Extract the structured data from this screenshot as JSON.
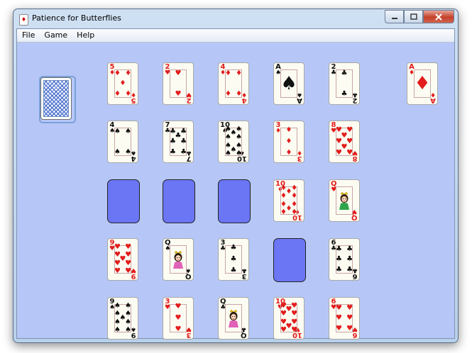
{
  "window": {
    "title": "Patience for Butterflies"
  },
  "menu": [
    "File",
    "Game",
    "Help"
  ],
  "foundation": {
    "rank": "A",
    "suit": "♦",
    "color": "red"
  },
  "grid": [
    [
      {
        "rank": "5",
        "suit": "♦",
        "color": "red"
      },
      {
        "rank": "2",
        "suit": "♥",
        "color": "red"
      },
      {
        "rank": "4",
        "suit": "♦",
        "color": "red"
      },
      {
        "rank": "A",
        "suit": "♠",
        "color": "black"
      },
      {
        "rank": "2",
        "suit": "♣",
        "color": "black"
      }
    ],
    [
      {
        "rank": "4",
        "suit": "♠",
        "color": "black"
      },
      {
        "rank": "7",
        "suit": "♣",
        "color": "black"
      },
      {
        "rank": "10",
        "suit": "♠",
        "color": "black"
      },
      {
        "rank": "3",
        "suit": "♦",
        "color": "red"
      },
      {
        "rank": "8",
        "suit": "♥",
        "color": "red"
      }
    ],
    [
      null,
      null,
      null,
      {
        "rank": "10",
        "suit": "♦",
        "color": "red"
      },
      {
        "rank": "Q",
        "suit": "♥",
        "color": "red"
      }
    ],
    [
      {
        "rank": "9",
        "suit": "♥",
        "color": "red"
      },
      {
        "rank": "Q",
        "suit": "♠",
        "color": "black"
      },
      {
        "rank": "3",
        "suit": "♣",
        "color": "black"
      },
      null,
      {
        "rank": "6",
        "suit": "♣",
        "color": "black"
      }
    ],
    [
      {
        "rank": "9",
        "suit": "♠",
        "color": "black"
      },
      {
        "rank": "3",
        "suit": "♥",
        "color": "red"
      },
      {
        "rank": "Q",
        "suit": "♣",
        "color": "black"
      },
      {
        "rank": "10",
        "suit": "♥",
        "color": "red"
      },
      {
        "rank": "6",
        "suit": "♥",
        "color": "red"
      }
    ]
  ],
  "colors": {
    "felt": "#b6c7f7",
    "empty_slot": "#6b76f5",
    "red_suit": "#e21c1c",
    "black_suit": "#111111"
  }
}
